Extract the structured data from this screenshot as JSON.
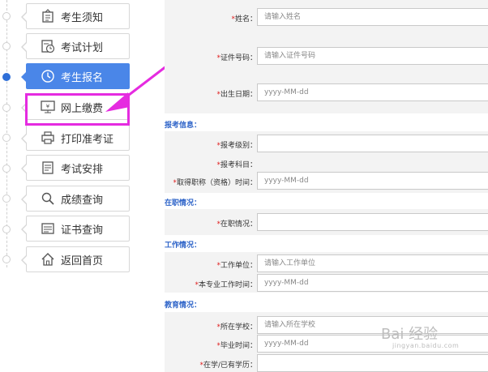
{
  "sidebar": {
    "items": [
      {
        "label": "考生须知",
        "icon": "notice-icon",
        "active": false
      },
      {
        "label": "考试计划",
        "icon": "calendar-clock-icon",
        "active": false
      },
      {
        "label": "考生报名",
        "icon": "clock-icon",
        "active": true
      },
      {
        "label": "网上缴费",
        "icon": "payment-monitor-icon",
        "active": false
      },
      {
        "label": "打印准考证",
        "icon": "printer-icon",
        "active": false
      },
      {
        "label": "考试安排",
        "icon": "document-icon",
        "active": false
      },
      {
        "label": "成绩查询",
        "icon": "search-icon",
        "active": false
      },
      {
        "label": "证书查询",
        "icon": "certificate-icon",
        "active": false
      },
      {
        "label": "返回首页",
        "icon": "home-icon",
        "active": false
      }
    ]
  },
  "annotation": {
    "color": "#e52be0",
    "target": "网上缴费"
  },
  "form": {
    "name": {
      "required": "*",
      "label": "姓名：",
      "placeholder": "请输入姓名"
    },
    "id_number": {
      "required": "*",
      "label": "证件号码：",
      "placeholder": "请输入证件号码"
    },
    "birth_date": {
      "required": "*",
      "label": "出生日期：",
      "placeholder": "yyyy-MM-dd"
    },
    "section_exam": "报考信息：",
    "exam_level": {
      "required": "*",
      "label": "报考级别：",
      "value": ""
    },
    "exam_subject": {
      "required": "*",
      "label": "报考科目：",
      "value": ""
    },
    "title_time": {
      "required": "*",
      "label": "取得职称（资格）时间：",
      "placeholder": "yyyy-MM-dd"
    },
    "section_employment": "在职情况：",
    "employment_status": {
      "required": "*",
      "label": "在职情况：",
      "value": ""
    },
    "section_work": "工作情况：",
    "work_unit": {
      "required": "*",
      "label": "工作单位：",
      "placeholder": "请输入工作单位"
    },
    "work_time": {
      "required": "*",
      "label": "本专业工作时间：",
      "placeholder": "yyyy-MM-dd"
    },
    "section_education": "教育情况：",
    "school": {
      "required": "*",
      "label": "所在学校：",
      "placeholder": "请输入所在学校"
    },
    "graduation_time": {
      "required": "*",
      "label": "毕业时间：",
      "placeholder": "yyyy-MM-dd"
    },
    "education": {
      "required": "*",
      "label": "在学/已有学历：",
      "value": ""
    }
  },
  "watermark": {
    "main": "Bai 经验",
    "sub": "jingyan.baidu.com"
  },
  "colors": {
    "accent": "#4a86e8",
    "section": "#2d63c8",
    "required": "#e02020",
    "highlight": "#e52be0"
  }
}
